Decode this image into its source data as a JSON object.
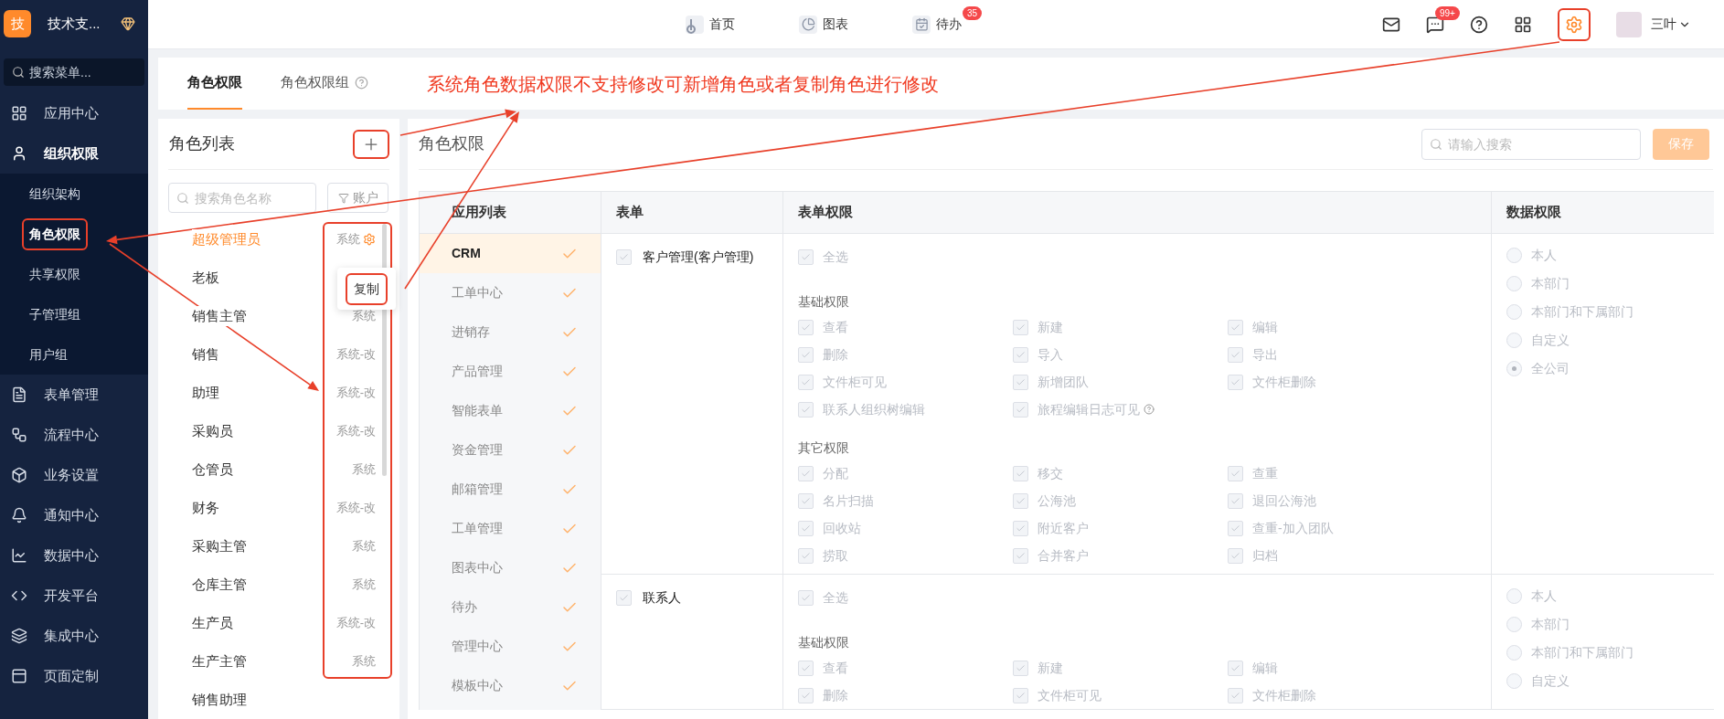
{
  "sidebar": {
    "logo_text": "技",
    "org_name": "技术支...",
    "search": {
      "placeholder": "搜索菜单..."
    },
    "items": [
      {
        "label": "应用中心",
        "active": false
      },
      {
        "label": "组织权限",
        "active": true,
        "children": [
          {
            "label": "组织架构",
            "selected": false,
            "annotated": false
          },
          {
            "label": "角色权限",
            "selected": true,
            "annotated": true
          },
          {
            "label": "共享权限",
            "selected": false,
            "annotated": false
          },
          {
            "label": "子管理组",
            "selected": false,
            "annotated": false
          },
          {
            "label": "用户组",
            "selected": false,
            "annotated": false
          }
        ]
      },
      {
        "label": "表单管理",
        "active": false
      },
      {
        "label": "流程中心",
        "active": false
      },
      {
        "label": "业务设置",
        "active": false
      },
      {
        "label": "通知中心",
        "active": false
      },
      {
        "label": "数据中心",
        "active": false
      },
      {
        "label": "开发平台",
        "active": false
      },
      {
        "label": "集成中心",
        "active": false
      },
      {
        "label": "页面定制",
        "active": false
      }
    ]
  },
  "topbar": {
    "nav": [
      {
        "label": "首页"
      },
      {
        "label": "图表"
      },
      {
        "label": "待办",
        "badge": "35"
      }
    ],
    "messages_badge": "99+",
    "settings_annotated": true,
    "user_name": "三叶"
  },
  "tabs": [
    {
      "label": "角色权限",
      "selected": true,
      "help": false
    },
    {
      "label": "角色权限组",
      "selected": false,
      "help": true
    }
  ],
  "annotation_note": "系统角色数据权限不支持修改可新增角色或者复制角色进行修改",
  "role_list": {
    "title": "角色列表",
    "add_annotated": true,
    "tags_annotated": true,
    "search": {
      "placeholder": "搜索角色名称"
    },
    "filter_label": "账户",
    "roles": [
      {
        "name": "超级管理员",
        "tag": "系统",
        "gear": true,
        "selected": true
      },
      {
        "name": "老板",
        "selected": false
      },
      {
        "name": "销售主管",
        "tag": "系统",
        "selected": false
      },
      {
        "name": "销售",
        "tag": "系统-改",
        "selected": false
      },
      {
        "name": "助理",
        "tag": "系统-改",
        "selected": false
      },
      {
        "name": "采购员",
        "tag": "系统-改",
        "selected": false
      },
      {
        "name": "仓管员",
        "tag": "系统",
        "selected": false
      },
      {
        "name": "财务",
        "tag": "系统-改",
        "selected": false
      },
      {
        "name": "采购主管",
        "tag": "系统",
        "selected": false
      },
      {
        "name": "仓库主管",
        "tag": "系统",
        "selected": false
      },
      {
        "name": "生产员",
        "tag": "系统-改",
        "selected": false
      },
      {
        "name": "生产主管",
        "tag": "系统",
        "selected": false
      },
      {
        "name": "销售助理",
        "selected": false
      }
    ],
    "context_menu": [
      {
        "label": "复制",
        "annotated": true
      }
    ]
  },
  "permissions": {
    "title": "角色权限",
    "search": {
      "placeholder": "请输入搜索"
    },
    "save": {
      "label": "保存",
      "disabled": true
    },
    "columns": [
      "应用列表",
      "表单",
      "表单权限",
      "数据权限"
    ],
    "apps": [
      {
        "name": "CRM",
        "checked": true,
        "selected": true
      },
      {
        "name": "工单中心",
        "checked": true,
        "selected": false
      },
      {
        "name": "进销存",
        "checked": true,
        "selected": false
      },
      {
        "name": "产品管理",
        "checked": true,
        "selected": false
      },
      {
        "name": "智能表单",
        "checked": true,
        "selected": false
      },
      {
        "name": "资金管理",
        "checked": true,
        "selected": false
      },
      {
        "name": "邮箱管理",
        "checked": true,
        "selected": false
      },
      {
        "name": "工单管理",
        "checked": true,
        "selected": false
      },
      {
        "name": "图表中心",
        "checked": true,
        "selected": false
      },
      {
        "name": "待办",
        "checked": true,
        "selected": false
      },
      {
        "name": "管理中心",
        "checked": true,
        "selected": false
      },
      {
        "name": "模板中心",
        "checked": true,
        "selected": false
      }
    ],
    "forms": [
      {
        "name": "客户管理(客户管理)",
        "checked": true,
        "select_all": {
          "label": "全选",
          "checked": true
        },
        "groups": [
          {
            "title": "基础权限",
            "items": [
              {
                "label": "查看",
                "checked": true
              },
              {
                "label": "新建",
                "checked": true
              },
              {
                "label": "编辑",
                "checked": true
              },
              {
                "label": "删除",
                "checked": true
              },
              {
                "label": "导入",
                "checked": true
              },
              {
                "label": "导出",
                "checked": true
              },
              {
                "label": "文件柜可见",
                "checked": true
              },
              {
                "label": "新增团队",
                "checked": true
              },
              {
                "label": "文件柜删除",
                "checked": true
              },
              {
                "label": "联系人组织树编辑",
                "checked": true
              },
              {
                "label": "旅程编辑日志可见",
                "checked": true,
                "help": true
              }
            ]
          },
          {
            "title": "其它权限",
            "items": [
              {
                "label": "分配",
                "checked": true
              },
              {
                "label": "移交",
                "checked": true
              },
              {
                "label": "查重",
                "checked": true
              },
              {
                "label": "名片扫描",
                "checked": true
              },
              {
                "label": "公海池",
                "checked": true
              },
              {
                "label": "退回公海池",
                "checked": true
              },
              {
                "label": "回收站",
                "checked": true
              },
              {
                "label": "附近客户",
                "checked": true
              },
              {
                "label": "查重-加入团队",
                "checked": true
              },
              {
                "label": "捞取",
                "checked": true
              },
              {
                "label": "合并客户",
                "checked": true
              },
              {
                "label": "归档",
                "checked": true
              }
            ]
          }
        ],
        "data_scope": [
          {
            "label": "本人",
            "selected": false
          },
          {
            "label": "本部门",
            "selected": false
          },
          {
            "label": "本部门和下属部门",
            "selected": false
          },
          {
            "label": "自定义",
            "selected": false
          },
          {
            "label": "全公司",
            "selected": true
          }
        ]
      },
      {
        "name": "联系人",
        "checked": true,
        "select_all": {
          "label": "全选",
          "checked": true
        },
        "groups": [
          {
            "title": "基础权限",
            "items": [
              {
                "label": "查看",
                "checked": true
              },
              {
                "label": "新建",
                "checked": true
              },
              {
                "label": "编辑",
                "checked": true
              },
              {
                "label": "删除",
                "checked": true
              },
              {
                "label": "文件柜可见",
                "checked": true
              },
              {
                "label": "文件柜删除",
                "checked": true
              }
            ]
          }
        ],
        "data_scope": [
          {
            "label": "本人",
            "selected": false
          },
          {
            "label": "本部门",
            "selected": false
          },
          {
            "label": "本部门和下属部门",
            "selected": false
          },
          {
            "label": "自定义",
            "selected": false
          }
        ]
      }
    ]
  }
}
